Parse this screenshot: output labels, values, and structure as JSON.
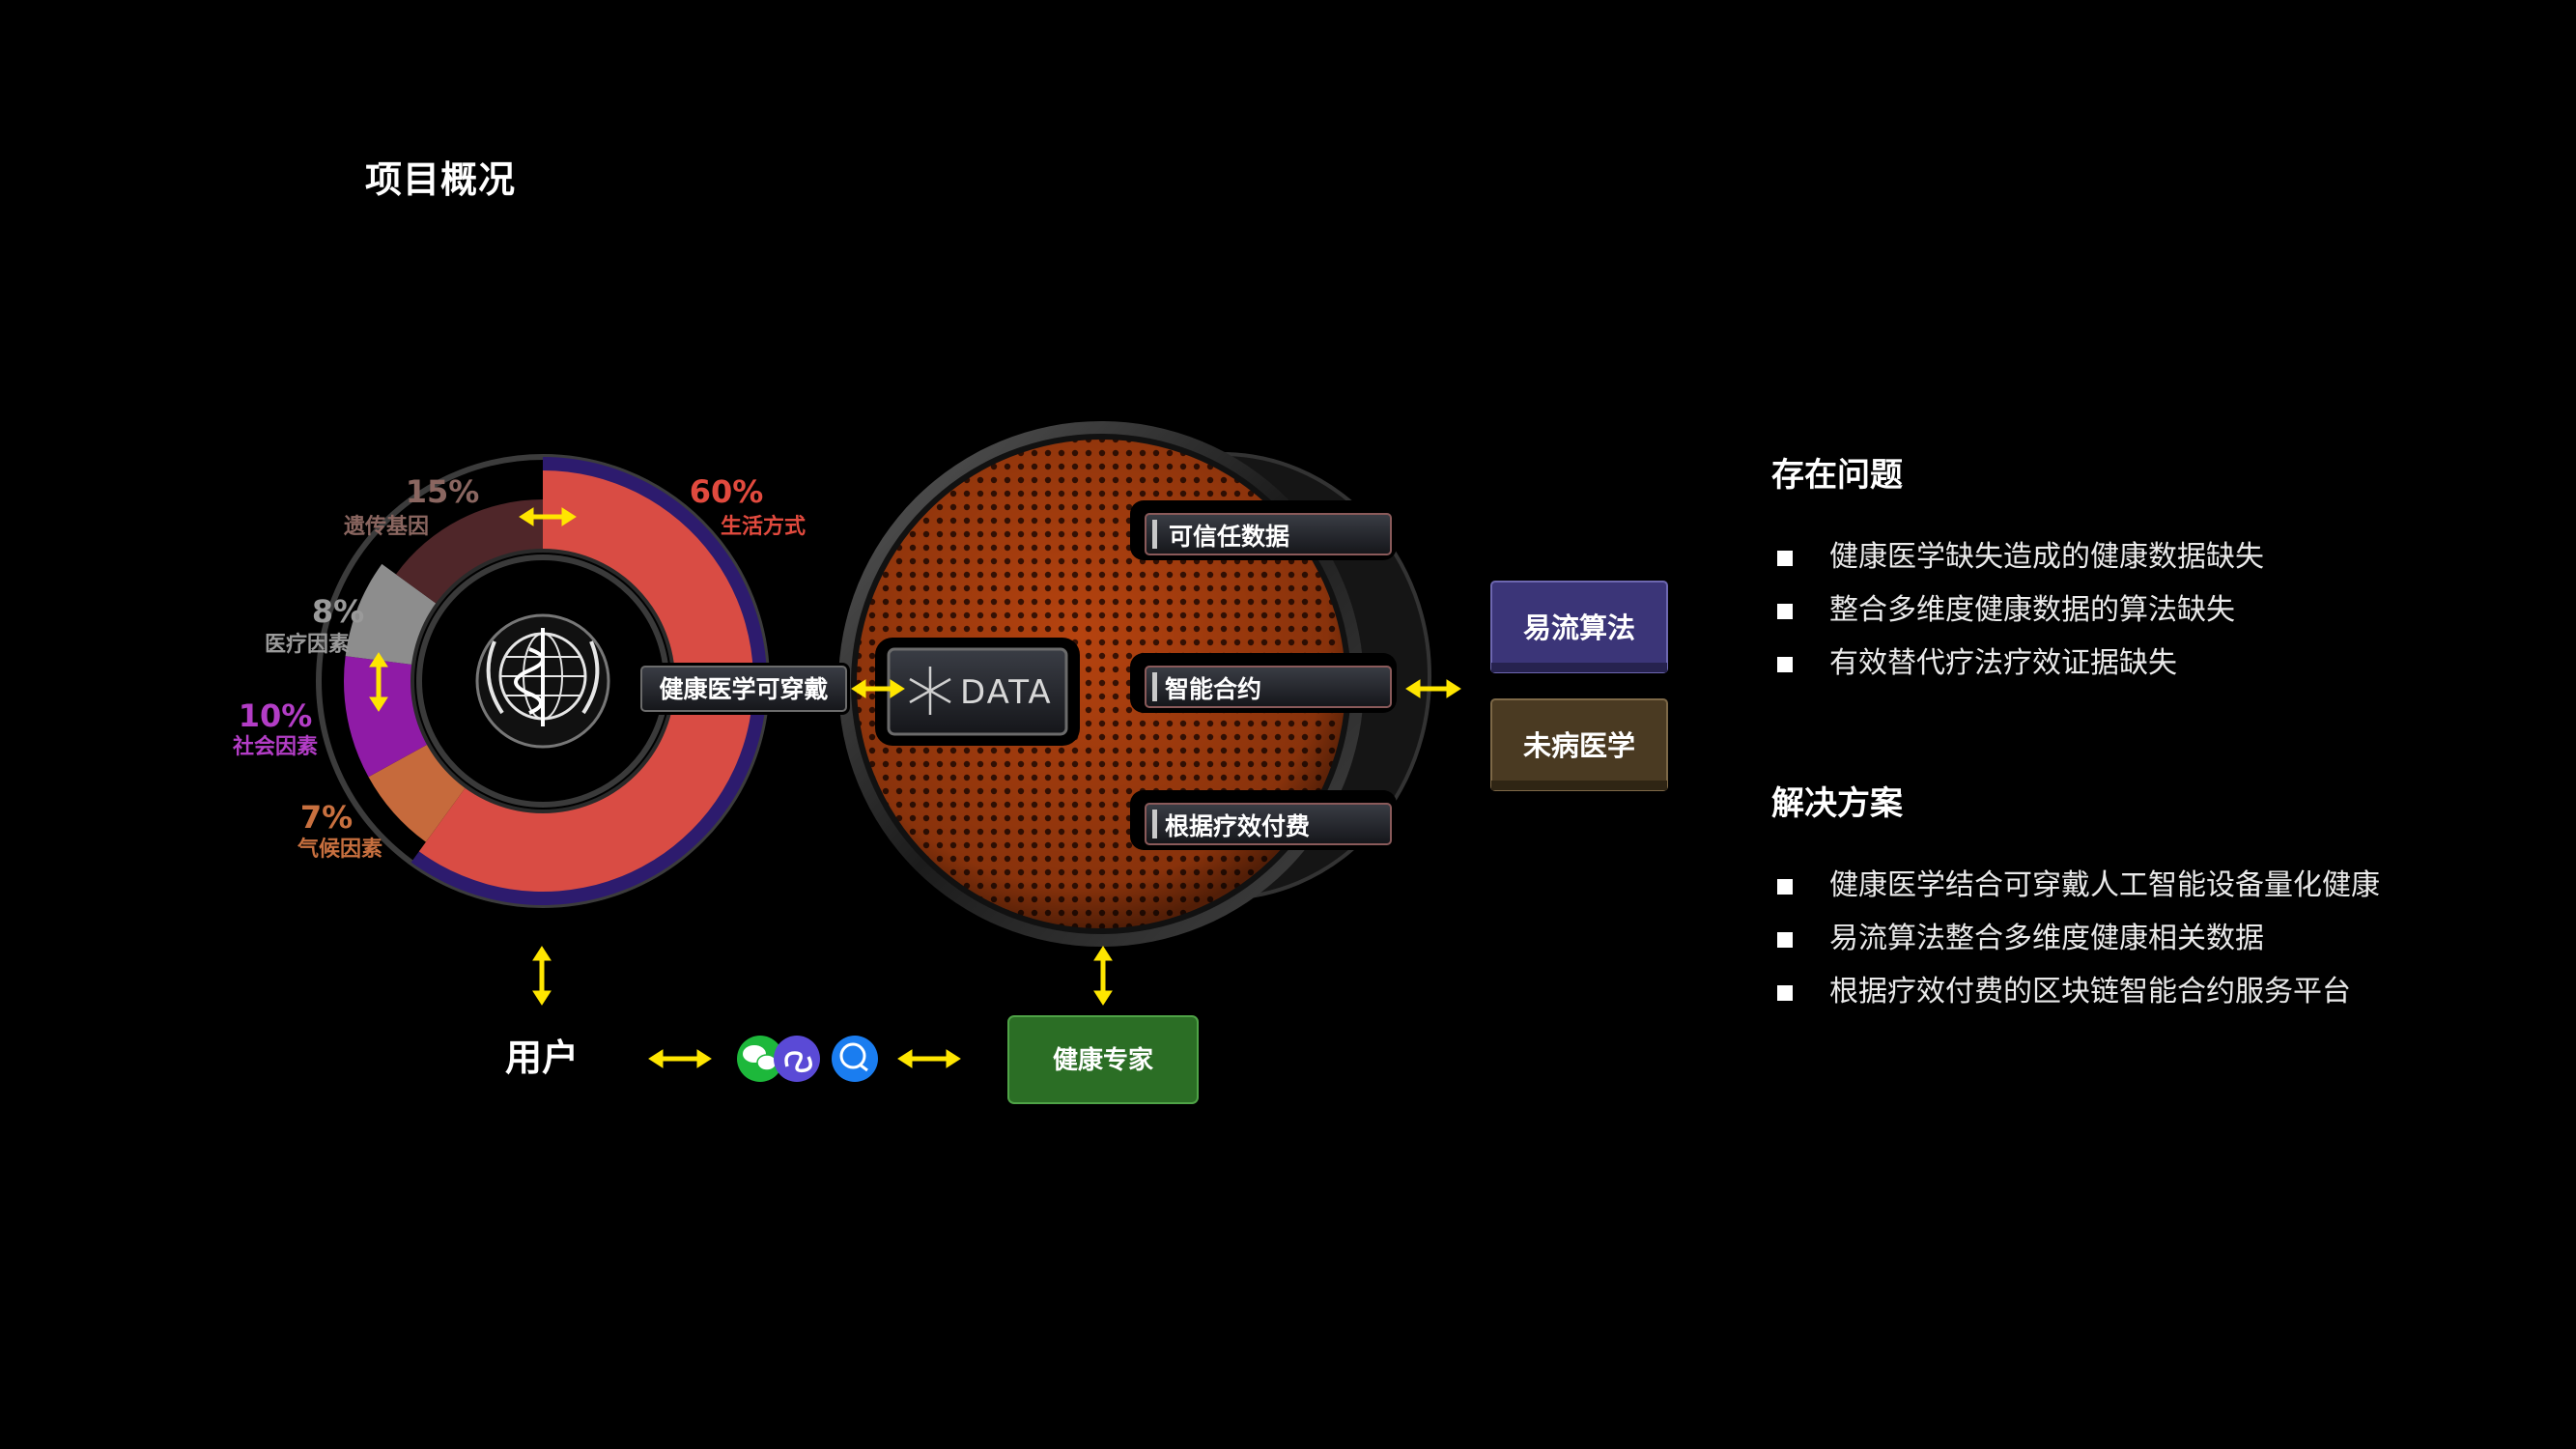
{
  "page_title": "项目概况",
  "donut": {
    "segments": [
      {
        "pct": "60%",
        "label": "生活方式",
        "value": 60,
        "color": "#d94c44"
      },
      {
        "pct": "7%",
        "label": "气候因素",
        "value": 7,
        "color": "#c66a3c"
      },
      {
        "pct": "10%",
        "label": "社会因素",
        "value": 10,
        "color": "#8f1ba6"
      },
      {
        "pct": "8%",
        "label": "医疗因素",
        "value": 8,
        "color": "#8d8d8d"
      },
      {
        "pct": "15%",
        "label": "遗传基因",
        "value": 15,
        "color": "#4f2629"
      }
    ],
    "outer_ring_color": "#2d1b6e"
  },
  "wearable_label": "健康医学可穿戴",
  "data_label": "DATA",
  "sphere_items": [
    "可信任数据",
    "智能合约",
    "根据疗效付费"
  ],
  "right_boxes": [
    {
      "label": "易流算法",
      "color": "#3b3578"
    },
    {
      "label": "未病医学",
      "color": "#4a3a22"
    }
  ],
  "user_label": "用户",
  "expert_label": "健康专家",
  "app_icons": [
    "wechat-icon",
    "mini-program-icon",
    "chat-app-icon"
  ],
  "arrow_color": "#ffe600",
  "problems": {
    "heading": "存在问题",
    "items": [
      "健康医学缺失造成的健康数据缺失",
      "整合多维度健康数据的算法缺失",
      "有效替代疗法疗效证据缺失"
    ]
  },
  "solutions": {
    "heading": "解决方案",
    "items": [
      "健康医学结合可穿戴人工智能设备量化健康",
      "易流算法整合多维度健康相关数据",
      "根据疗效付费的区块链智能合约服务平台"
    ]
  }
}
